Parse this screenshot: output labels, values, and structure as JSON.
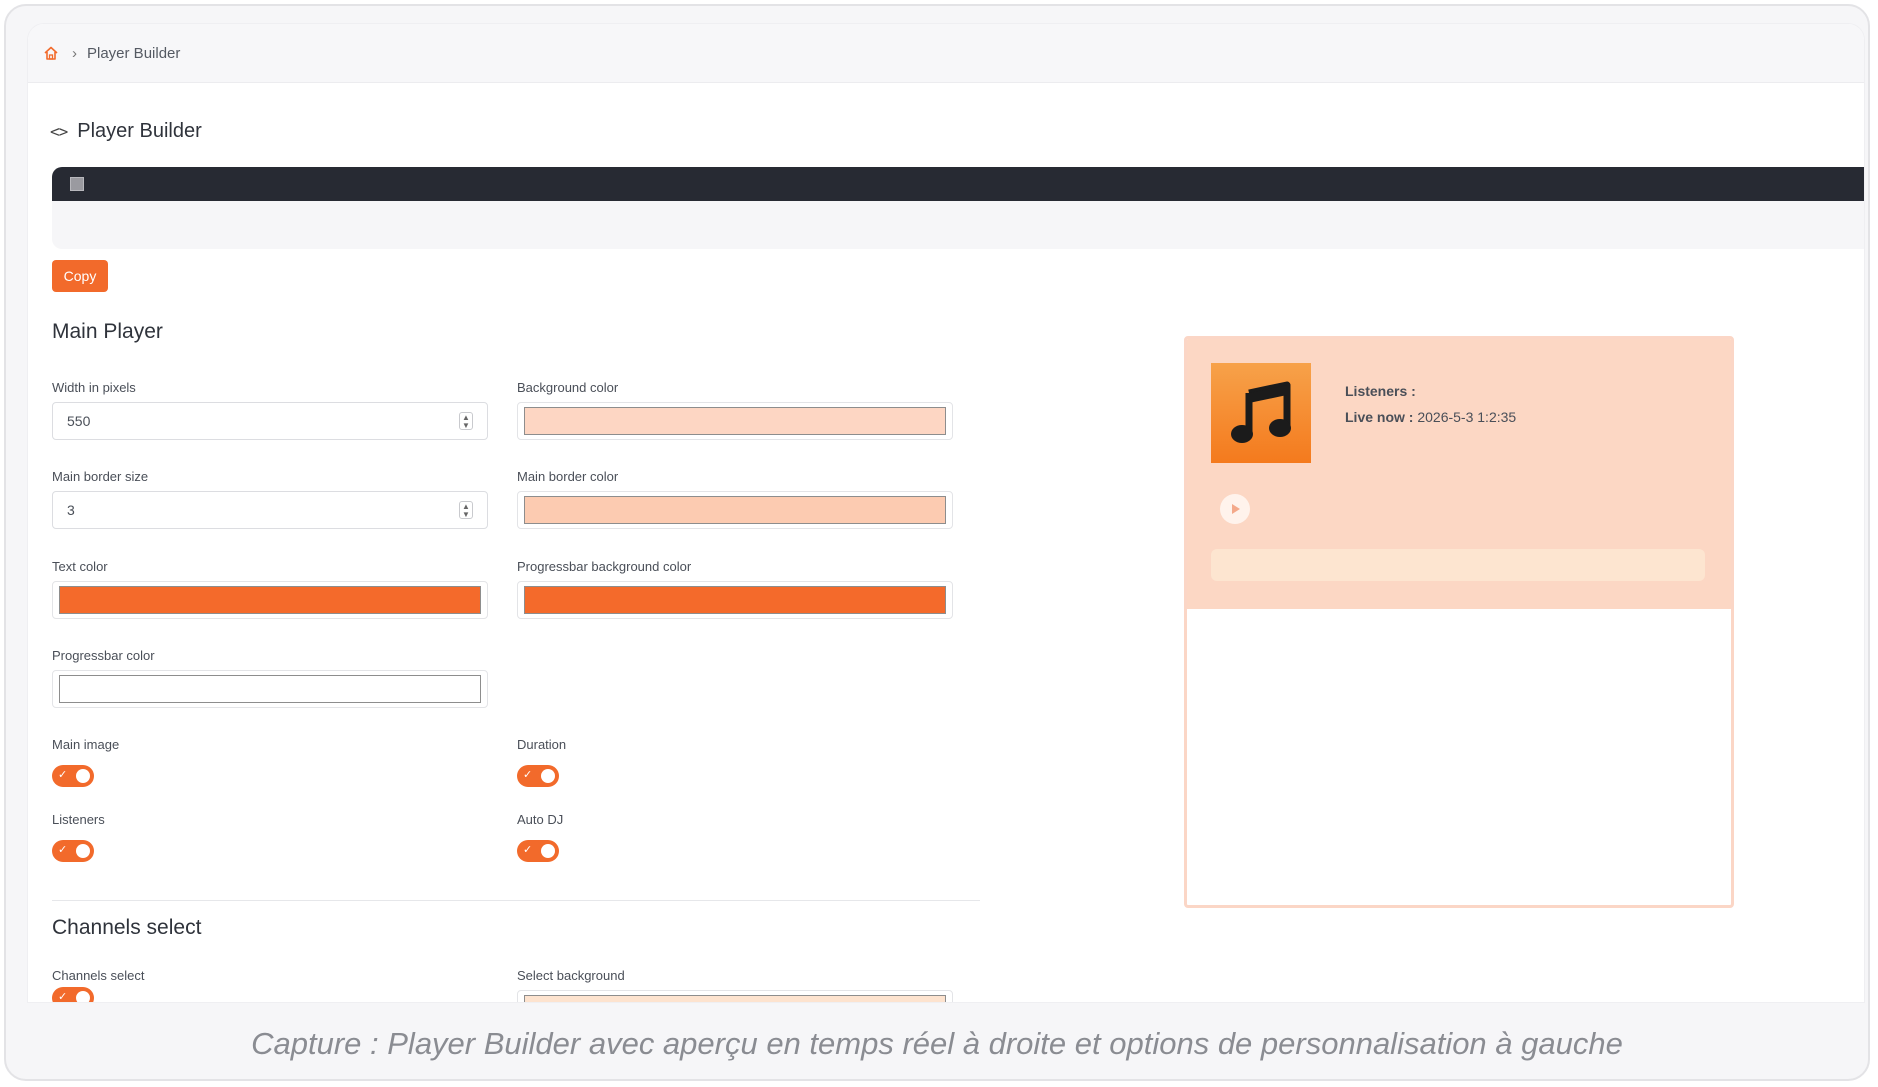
{
  "breadcrumb": {
    "home_icon": "home-icon",
    "current": "Player Builder"
  },
  "page": {
    "title": "Player Builder",
    "title_icon": "code-icon"
  },
  "toolbar": {
    "copy_label": "Copy"
  },
  "main_player": {
    "section_title": "Main Player",
    "width": {
      "label": "Width in pixels",
      "value": "550"
    },
    "background_color": {
      "label": "Background color",
      "value": "#fdd6c3"
    },
    "border_size": {
      "label": "Main border size",
      "value": "3"
    },
    "border_color": {
      "label": "Main border color",
      "value": "#fccbb1"
    },
    "text_color": {
      "label": "Text color",
      "value": "#f46a2b"
    },
    "progressbar_bg_color": {
      "label": "Progressbar background color",
      "value": "#f46a2b"
    },
    "progressbar_color": {
      "label": "Progressbar color",
      "value": "#ffffff"
    },
    "main_image": {
      "label": "Main image",
      "enabled": true
    },
    "duration": {
      "label": "Duration",
      "enabled": true
    },
    "listeners": {
      "label": "Listeners",
      "enabled": true
    },
    "auto_dj": {
      "label": "Auto DJ",
      "enabled": true
    }
  },
  "channels": {
    "section_title": "Channels select",
    "channels_select": {
      "label": "Channels select",
      "enabled": true
    },
    "select_background": {
      "label": "Select background",
      "value": "#fde3cf"
    }
  },
  "preview": {
    "listeners_label": "Listeners :",
    "live_label": "Live now :",
    "live_value": "2026-5-3 1:2:35",
    "cover_icon": "music-note-icon",
    "play_icon": "play-icon"
  },
  "caption": "Capture : Player Builder avec aperçu en temps réel à droite et options de personnalisation à gauche",
  "colors": {
    "accent": "#f26a2b",
    "code_bar": "#272a33"
  }
}
